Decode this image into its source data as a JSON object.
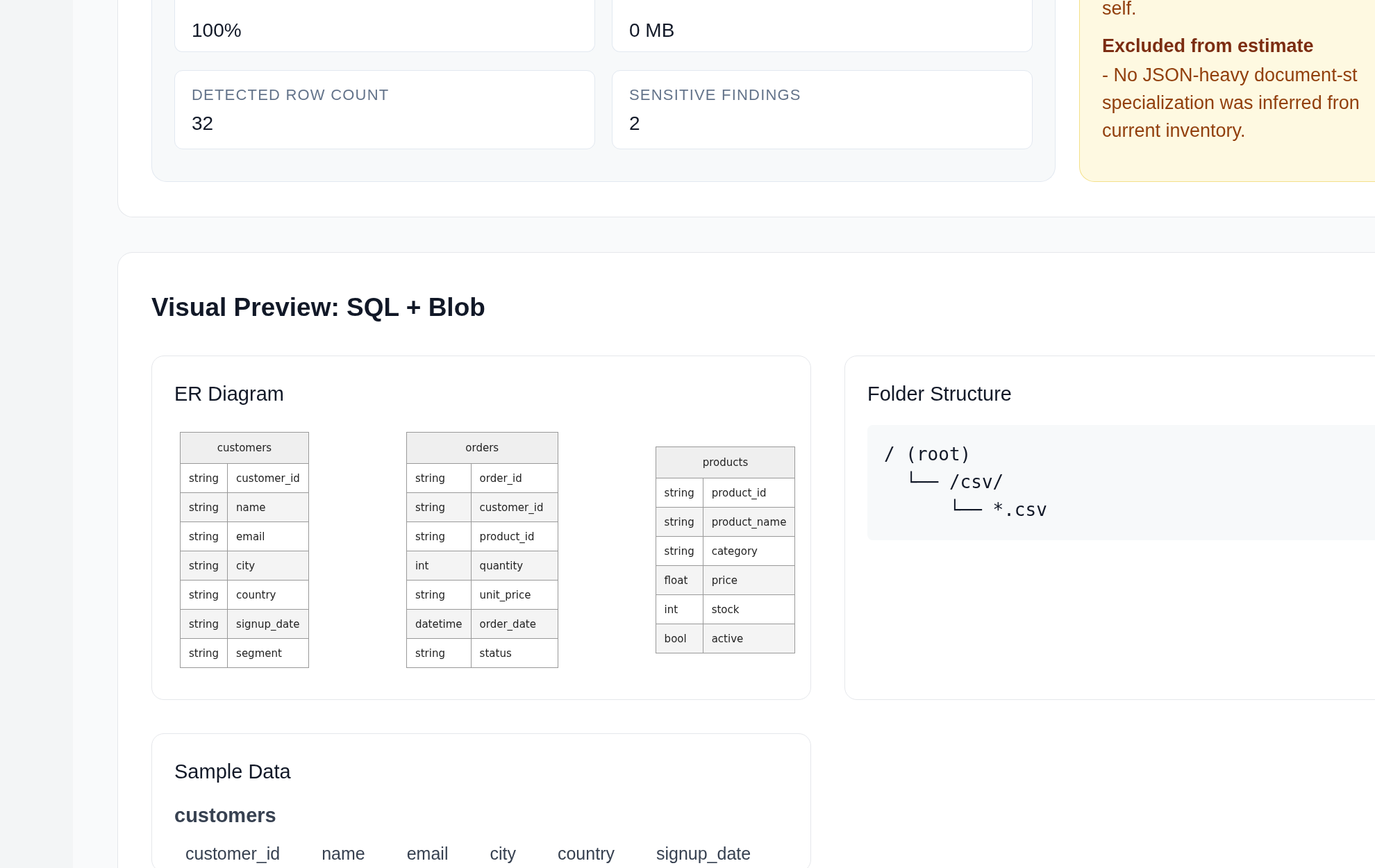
{
  "summary": {
    "stats": [
      {
        "value": "100%"
      },
      {
        "value": "0 MB"
      },
      {
        "label": "DETECTED ROW COUNT",
        "value": "32"
      },
      {
        "label": "SENSITIVE FINDINGS",
        "value": "2"
      }
    ],
    "note": {
      "top_text": "self.",
      "heading": "Excluded from estimate",
      "lines": [
        "- No JSON-heavy document-st",
        "specialization was inferred fron",
        "current inventory."
      ]
    }
  },
  "preview": {
    "title": "Visual Preview: SQL + Blob",
    "er_diagram": {
      "title": "ER Diagram",
      "tables": [
        {
          "name": "customers",
          "fields": [
            {
              "type": "string",
              "name": "customer_id"
            },
            {
              "type": "string",
              "name": "name"
            },
            {
              "type": "string",
              "name": "email"
            },
            {
              "type": "string",
              "name": "city"
            },
            {
              "type": "string",
              "name": "country"
            },
            {
              "type": "string",
              "name": "signup_date"
            },
            {
              "type": "string",
              "name": "segment"
            }
          ]
        },
        {
          "name": "orders",
          "fields": [
            {
              "type": "string",
              "name": "order_id"
            },
            {
              "type": "string",
              "name": "customer_id"
            },
            {
              "type": "string",
              "name": "product_id"
            },
            {
              "type": "int",
              "name": "quantity"
            },
            {
              "type": "string",
              "name": "unit_price"
            },
            {
              "type": "datetime",
              "name": "order_date"
            },
            {
              "type": "string",
              "name": "status"
            }
          ]
        },
        {
          "name": "products",
          "fields": [
            {
              "type": "string",
              "name": "product_id"
            },
            {
              "type": "string",
              "name": "product_name"
            },
            {
              "type": "string",
              "name": "category"
            },
            {
              "type": "float",
              "name": "price"
            },
            {
              "type": "int",
              "name": "stock"
            },
            {
              "type": "bool",
              "name": "active"
            }
          ]
        }
      ]
    },
    "folder_structure": {
      "title": "Folder Structure",
      "lines": [
        "/ (root)",
        "  └── /csv/",
        "      └── *.csv"
      ]
    },
    "sample_data": {
      "title": "Sample Data",
      "table_name": "customers",
      "columns": [
        "customer_id",
        "name",
        "email",
        "city",
        "country",
        "signup_date"
      ]
    }
  }
}
